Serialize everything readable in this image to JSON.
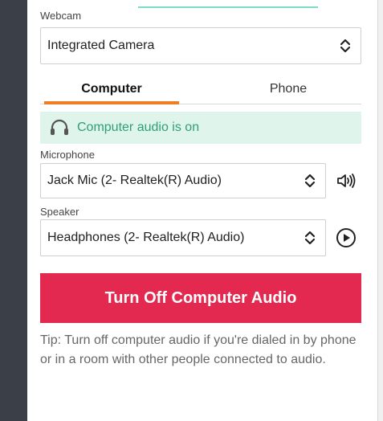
{
  "webcam": {
    "label": "Webcam",
    "selected": "Integrated Camera"
  },
  "tabs": [
    {
      "label": "Computer",
      "active": true
    },
    {
      "label": "Phone",
      "active": false
    }
  ],
  "status": {
    "text": "Computer audio is on",
    "icon": "headset-icon",
    "color": "#2f9e7a"
  },
  "microphone": {
    "label": "Microphone",
    "selected": "Jack Mic (2- Realtek(R) Audio)",
    "icon": "speaker-volume-icon"
  },
  "speaker": {
    "label": "Speaker",
    "selected": "Headphones (2- Realtek(R) Audio)",
    "icon": "play-circle-icon"
  },
  "primary_button": {
    "label": "Turn Off Computer Audio",
    "color": "#e3294f"
  },
  "tip": {
    "text": "Tip: Turn off computer audio if you're dialed in by phone or in a room with other people connected to audio."
  },
  "colors": {
    "accent_tab": "#f07d22",
    "status_bg": "#dff5ec",
    "sidebar": "#3a3f48"
  }
}
